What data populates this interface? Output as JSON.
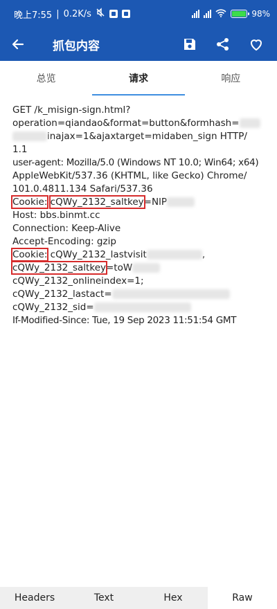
{
  "status_bar": {
    "time": "晚上7:55",
    "speed": "0.2K/s",
    "battery": "98%"
  },
  "app_bar": {
    "title": "抓包内容",
    "icons": [
      "back-arrow-icon",
      "save-icon",
      "share-icon",
      "heart-icon"
    ]
  },
  "tabs": [
    {
      "label": "总览",
      "active": false
    },
    {
      "label": "请求",
      "active": true
    },
    {
      "label": "响应",
      "active": false
    }
  ],
  "request": {
    "line1": "GET /k_misign-sign.html?",
    "line2": "operation=qiandao&format=button&formhash=",
    "line3": "inajax=1&ajaxtarget=midaben_sign HTTP/",
    "line4": "1.1",
    "line5": "user-agent: Mozilla/5.0 (Windows NT 10.0; Win64; x64)",
    "line6": "AppleWebKit/537.36 (KHTML, like Gecko) Chrome/",
    "line7": "101.0.4811.134 Safari/537.36",
    "cookie1_label": "Cookie:",
    "cookie1_key": "cQWy_2132_saltkey",
    "cookie1_rest": "=NlP",
    "host": "Host: bbs.binmt.cc",
    "connection": "Connection: Keep-Alive",
    "encoding": "Accept-Encoding: gzip",
    "cookie2_label": "Cookie:",
    "cookie2_rest": " cQWy_2132_lastvisit",
    "cookie2_comma": ",",
    "cookie3_key": "cQWy_2132_saltkey",
    "cookie3_rest": "=toW",
    "cookie4": "cQWy_2132_onlineindex=1;",
    "cookie5": "cQWy_2132_lastact=",
    "cookie6": "cQWy_2132_sid=",
    "modified": "If-Modified-Since: Tue, 19 Sep 2023 11:51:54 GMT"
  },
  "bottom_tabs": [
    {
      "label": "Headers",
      "active": false
    },
    {
      "label": "Text",
      "active": false
    },
    {
      "label": "Hex",
      "active": false
    },
    {
      "label": "Raw",
      "active": true
    }
  ],
  "colors": {
    "primary": "#1c58b3",
    "accent": "#3d8de0",
    "highlight_box": "#d62b2b"
  }
}
